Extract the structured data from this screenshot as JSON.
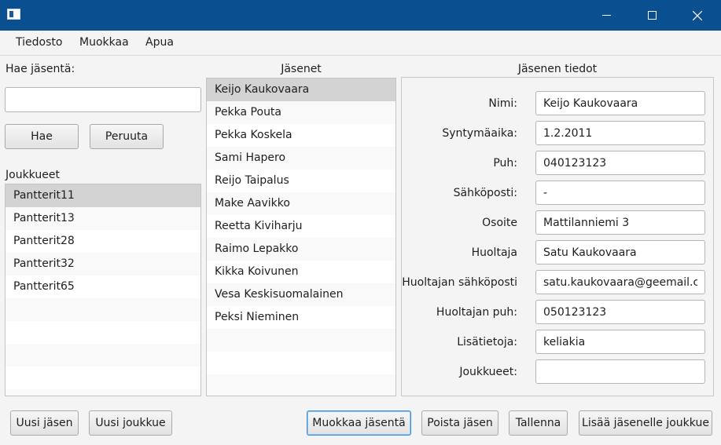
{
  "window": {
    "title": ""
  },
  "menu": [
    "Tiedosto",
    "Muokkaa",
    "Apua"
  ],
  "search": {
    "label": "Hae jäsentä:",
    "value": "",
    "search_button": "Hae",
    "cancel_button": "Peruuta"
  },
  "teams": {
    "label": "Joukkueet",
    "items": [
      "Pantterit11",
      "Pantterit13",
      "Pantterit28",
      "Pantterit32",
      "Pantterit65"
    ],
    "selected": "Pantterit11"
  },
  "members": {
    "label": "Jäsenet",
    "items": [
      "Keijo Kaukovaara",
      "Pekka Pouta",
      "Pekka Koskela",
      "Sami Hapero",
      "Reijo Taipalus",
      "Make Aavikko",
      "Reetta Kiviharju",
      "Raimo Lepakko",
      "Kikka Koivunen",
      "Vesa Keskisuomalainen",
      "Peksi Nieminen"
    ],
    "selected": "Keijo Kaukovaara"
  },
  "details": {
    "title": "Jäsenen tiedot",
    "fields": [
      {
        "label": "Nimi:",
        "value": "Keijo Kaukovaara"
      },
      {
        "label": "Syntymäaika:",
        "value": "1.2.2011"
      },
      {
        "label": "Puh:",
        "value": "040123123"
      },
      {
        "label": "Sähköposti:",
        "value": "-"
      },
      {
        "label": "Osoite",
        "value": "Mattilanniemi 3"
      },
      {
        "label": "Huoltaja",
        "value": "Satu Kaukovaara"
      },
      {
        "label": "Huoltajan sähköposti",
        "value": "satu.kaukovaara@geemail.com"
      },
      {
        "label": "Huoltajan puh:",
        "value": "050123123"
      },
      {
        "label": "Lisätietoja:",
        "value": "keliakia"
      },
      {
        "label": "Joukkueet:",
        "value": ""
      }
    ]
  },
  "buttons": {
    "new_member": "Uusi jäsen",
    "new_team": "Uusi joukkue",
    "edit_member": "Muokkaa jäsentä",
    "delete_member": "Poista jäsen",
    "save": "Tallenna",
    "add_team_to_member": "Lisää jäsenelle joukkue"
  }
}
